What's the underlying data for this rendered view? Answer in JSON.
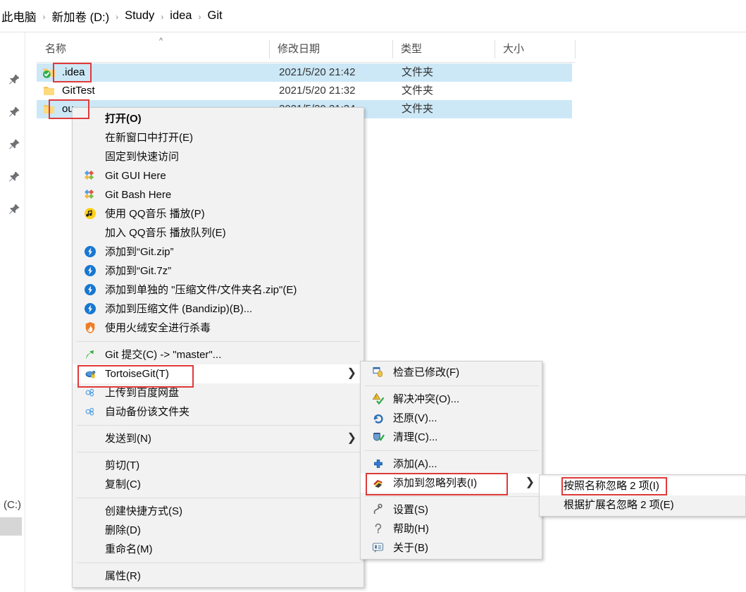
{
  "breadcrumb": {
    "separator": "›",
    "items": [
      "此电脑",
      "新加卷 (D:)",
      "Study",
      "idea",
      "Git"
    ]
  },
  "nav_pane": {
    "pin_icon": "pin-icon",
    "pin_count": 5,
    "clipped_drive_label": "D (C:)"
  },
  "file_list": {
    "columns": [
      {
        "label": "名称",
        "sort": "ascending"
      },
      {
        "label": "修改日期"
      },
      {
        "label": "类型"
      },
      {
        "label": "大小"
      }
    ],
    "rows": [
      {
        "name": ".idea",
        "date": "2021/5/20 21:42",
        "type": "文件夹",
        "size": "",
        "icon": "folder-git-ok-icon",
        "selected": true
      },
      {
        "name": "GitTest",
        "date": "2021/5/20 21:32",
        "type": "文件夹",
        "size": "",
        "icon": "folder-icon",
        "selected": false
      },
      {
        "name": "ou",
        "date": "2021/5/20 21:34",
        "type": "文件夹",
        "size": "",
        "icon": "folder-icon",
        "selected": true
      }
    ]
  },
  "context_menu": {
    "items": [
      {
        "label": "打开(O)",
        "icon": null,
        "bold": true
      },
      {
        "label": "在新窗口中打开(E)",
        "icon": null
      },
      {
        "label": "固定到快速访问",
        "icon": null
      },
      {
        "label": "Git GUI Here",
        "icon": "git-diamonds-icon"
      },
      {
        "label": "Git Bash Here",
        "icon": "git-diamonds-icon"
      },
      {
        "label": "使用 QQ音乐 播放(P)",
        "icon": "qqmusic-icon"
      },
      {
        "label": "加入 QQ音乐 播放队列(E)",
        "icon": null
      },
      {
        "label": "添加到“Git.zip”",
        "icon": "bandizip-icon"
      },
      {
        "label": "添加到“Git.7z”",
        "icon": "bandizip-icon"
      },
      {
        "label": "添加到单独的 \"压缩文件/文件夹名.zip\"(E)",
        "icon": "bandizip-icon"
      },
      {
        "label": "添加到压缩文件 (Bandizip)(B)...",
        "icon": "bandizip-icon"
      },
      {
        "label": "使用火绒安全进行杀毒",
        "icon": "huorong-icon"
      },
      {
        "separator": true
      },
      {
        "label": "Git 提交(C) -> \"master\"...",
        "icon": "git-commit-icon"
      },
      {
        "label": "TortoiseGit(T)",
        "icon": "tortoisegit-icon",
        "submenu": true,
        "highlighted": true
      },
      {
        "label": "上传到百度网盘",
        "icon": "baidu-cloud-icon"
      },
      {
        "label": "自动备份该文件夹",
        "icon": "baidu-cloud-icon"
      },
      {
        "separator": true
      },
      {
        "label": "发送到(N)",
        "icon": null,
        "submenu": true
      },
      {
        "separator": true
      },
      {
        "label": "剪切(T)",
        "icon": null
      },
      {
        "label": "复制(C)",
        "icon": null
      },
      {
        "separator": true
      },
      {
        "label": "创建快捷方式(S)",
        "icon": null
      },
      {
        "label": "删除(D)",
        "icon": null
      },
      {
        "label": "重命名(M)",
        "icon": null
      },
      {
        "separator": true
      },
      {
        "label": "属性(R)",
        "icon": null
      }
    ]
  },
  "tortoisegit_submenu": {
    "items": [
      {
        "label": "检查已修改(F)",
        "icon": "check-modified-icon"
      },
      {
        "separator": true
      },
      {
        "label": "解决冲突(O)...",
        "icon": "resolve-conflict-icon"
      },
      {
        "label": "还原(V)...",
        "icon": "revert-icon"
      },
      {
        "label": "清理(C)...",
        "icon": "cleanup-icon"
      },
      {
        "separator": true
      },
      {
        "label": "添加(A)...",
        "icon": "add-icon"
      },
      {
        "label": "添加到忽略列表(I)",
        "icon": "ignore-icon",
        "submenu": true,
        "highlighted": true
      },
      {
        "separator": true
      },
      {
        "label": "设置(S)",
        "icon": "settings-icon"
      },
      {
        "label": "帮助(H)",
        "icon": "help-icon"
      },
      {
        "label": "关于(B)",
        "icon": "about-icon"
      }
    ]
  },
  "ignore_submenu": {
    "items": [
      {
        "label": "按照名称忽略 2 项(I)",
        "highlighted": true
      },
      {
        "label": "根据扩展名忽略 2 项(E)"
      }
    ]
  },
  "colors": {
    "selection": "#cce8f7",
    "annotation": "#e03a3a",
    "menu_bg": "#f2f2f2",
    "menu_border": "#cfcfcf"
  }
}
